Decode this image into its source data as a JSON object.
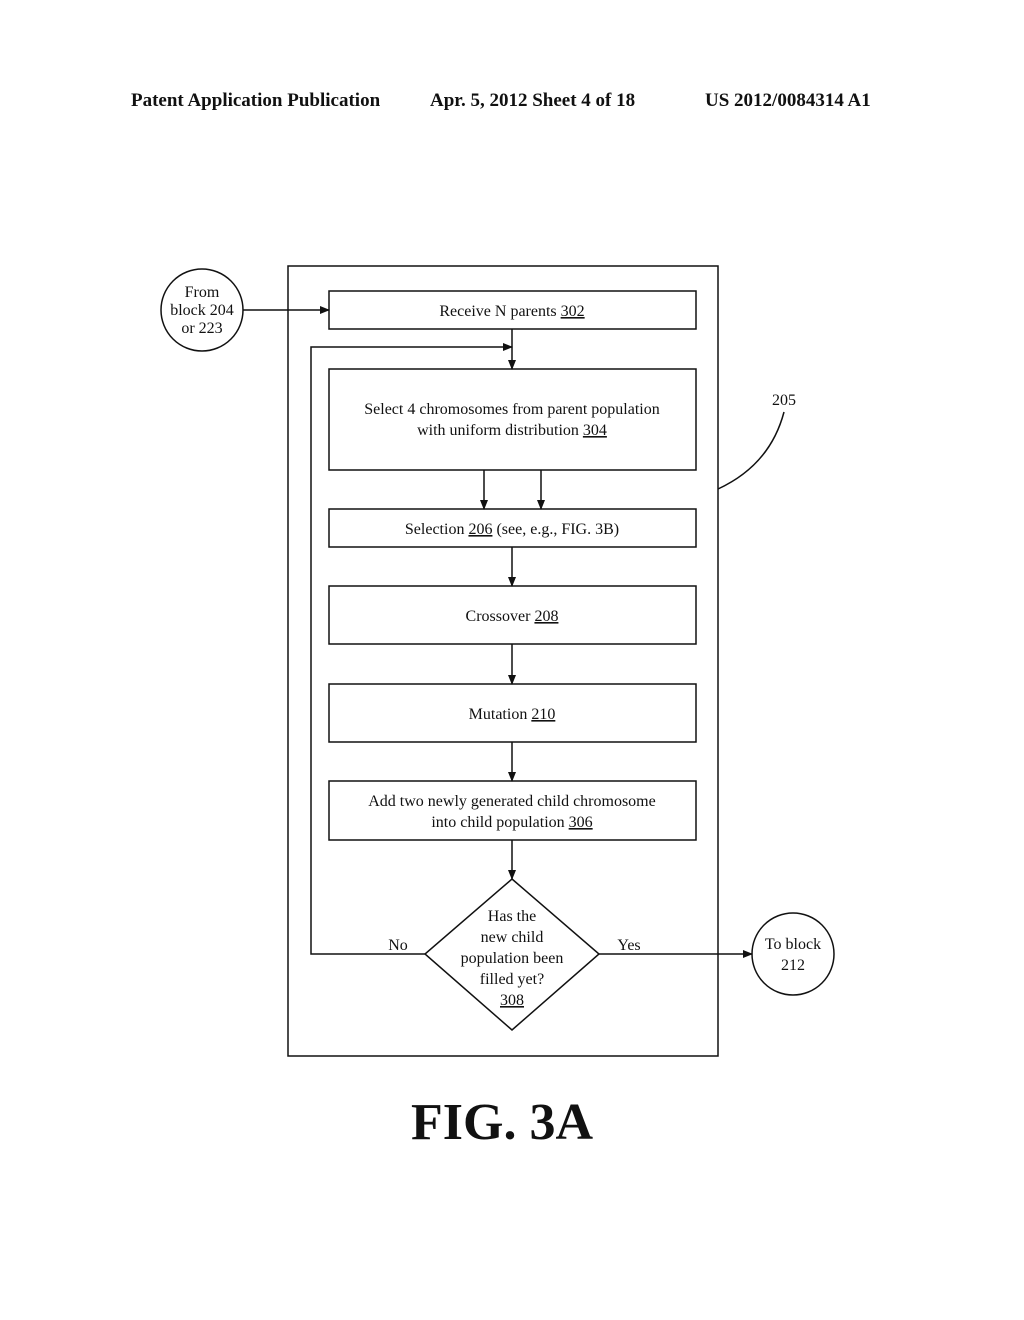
{
  "header": {
    "publication": "Patent Application Publication",
    "date_sheet": "Apr. 5, 2012   Sheet 4 of 18",
    "number": "US 2012/0084314 A1"
  },
  "flowchart": {
    "entry_connector": {
      "lines": [
        "From",
        "block 204",
        "or 223"
      ]
    },
    "exit_connector": {
      "lines": [
        "To block",
        "212"
      ]
    },
    "container_ref": "205",
    "boxes": [
      {
        "id": "302",
        "lines": [
          {
            "text": "Receive N parents ",
            "ref": "302"
          }
        ]
      },
      {
        "id": "304",
        "lines": [
          {
            "text": "Select 4 chromosomes from parent population",
            "ref": ""
          },
          {
            "text": "with uniform distribution ",
            "ref": "304"
          }
        ]
      },
      {
        "id": "206",
        "lines": [
          {
            "text": "Selection ",
            "ref": "206",
            "suffix": " (see, e.g., FIG. 3B)"
          }
        ]
      },
      {
        "id": "208",
        "lines": [
          {
            "text": "Crossover ",
            "ref": "208"
          }
        ]
      },
      {
        "id": "210",
        "lines": [
          {
            "text": "Mutation ",
            "ref": "210"
          }
        ]
      },
      {
        "id": "306",
        "lines": [
          {
            "text": "Add two newly generated child chromosome",
            "ref": ""
          },
          {
            "text": "into child population ",
            "ref": "306"
          }
        ]
      }
    ],
    "decision": {
      "id": "308",
      "lines": [
        "Has the",
        "new child",
        "population been",
        "filled yet?"
      ],
      "ref": "308",
      "no_label": "No",
      "yes_label": "Yes"
    }
  },
  "figure_label": "FIG. 3A"
}
